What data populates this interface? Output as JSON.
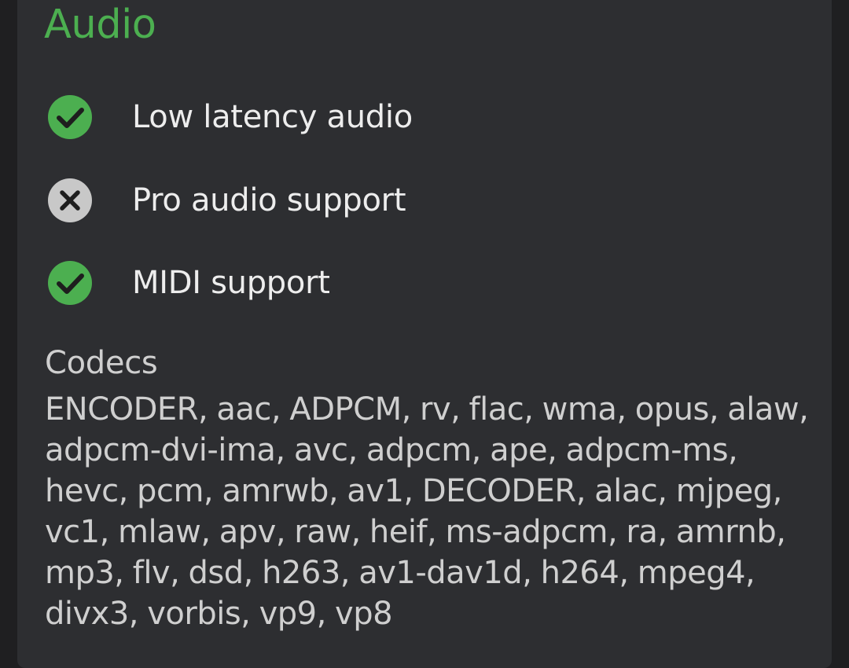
{
  "section": {
    "title": "Audio"
  },
  "features": [
    {
      "label": "Low latency audio",
      "supported": true,
      "icon": "check-circle-icon"
    },
    {
      "label": "Pro audio support",
      "supported": false,
      "icon": "x-circle-icon"
    },
    {
      "label": "MIDI support",
      "supported": true,
      "icon": "check-circle-icon"
    }
  ],
  "codecs": {
    "title": "Codecs",
    "list": "ENCODER, aac, ADPCM, rv, flac, wma, opus, alaw, adpcm-dvi-ima, avc, adpcm, ape, adpcm-ms, hevc, pcm, amrwb, av1, DECODER, alac, mjpeg, vc1, mlaw, apv, raw, heif, ms-adpcm, ra, amrnb, mp3, flv, dsd, h263, av1-dav1d, h264, mpeg4, divx3, vorbis, vp9, vp8"
  },
  "colors": {
    "accent": "#4caf50",
    "supported": "#4caf50",
    "unsupported": "#c8c8c8",
    "card_background": "#2d2e31",
    "page_background": "#1f1f21"
  }
}
